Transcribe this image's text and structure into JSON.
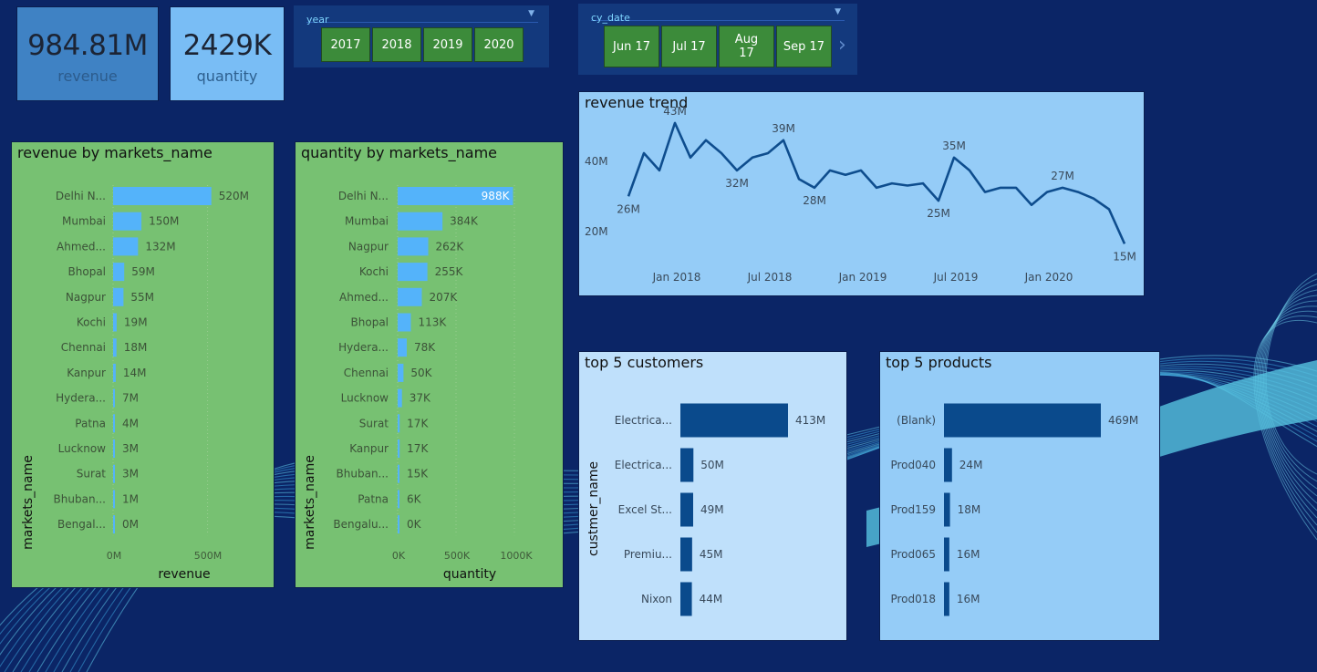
{
  "kpis": [
    {
      "value": "984.81M",
      "label": "revenue"
    },
    {
      "value": "2429K",
      "label": "quantity"
    }
  ],
  "year_slicer": {
    "title": "year",
    "items": [
      "2017",
      "2018",
      "2019",
      "2020"
    ]
  },
  "date_slicer": {
    "title": "cy_date",
    "items": [
      "Jun 17",
      "Jul 17",
      "Aug 17",
      "Sep 17"
    ]
  },
  "revenue_by_market": {
    "title": "revenue by markets_name",
    "xlabel": "revenue",
    "ylabel": "markets_name",
    "ticks": [
      "0M",
      "500M"
    ]
  },
  "quantity_by_market": {
    "title": "quantity by markets_name",
    "xlabel": "quantity",
    "ylabel": "markets_name",
    "ticks": [
      "0K",
      "500K",
      "1000K"
    ]
  },
  "revenue_trend": {
    "title": "revenue trend",
    "yticks": [
      "40M",
      "20M"
    ],
    "xticks": [
      "Jan 2018",
      "Jul 2018",
      "Jan 2019",
      "Jul 2019",
      "Jan 2020"
    ]
  },
  "top_customers": {
    "title": "top 5 customers",
    "ylabel": "custmer_name"
  },
  "top_products": {
    "title": "top 5 products"
  },
  "colors": {
    "background": "#0b2566",
    "green_panel": "#77c172",
    "blue_panel": "#95ccf7",
    "kpi_revenue": "#3f82c4",
    "kpi_quantity": "#79bdf5",
    "bar_light": "#54b3fa",
    "bar_dark": "#0a4a8c",
    "line": "#0e4d8e",
    "tile": "#3c8b3a"
  },
  "chart_data": [
    {
      "type": "bar",
      "orientation": "horizontal",
      "title": "revenue by markets_name",
      "xlabel": "revenue",
      "ylabel": "markets_name",
      "categories": [
        "Delhi N...",
        "Mumbai",
        "Ahmed...",
        "Bhopal",
        "Nagpur",
        "Kochi",
        "Chennai",
        "Kanpur",
        "Hydera...",
        "Patna",
        "Lucknow",
        "Surat",
        "Bhuban...",
        "Bengal..."
      ],
      "values": [
        520,
        150,
        132,
        59,
        55,
        19,
        18,
        14,
        7,
        4,
        3,
        3,
        1,
        0
      ],
      "labels": [
        "520M",
        "150M",
        "132M",
        "59M",
        "55M",
        "19M",
        "18M",
        "14M",
        "7M",
        "4M",
        "3M",
        "3M",
        "1M",
        "0M"
      ],
      "xlim": [
        0,
        700
      ]
    },
    {
      "type": "bar",
      "orientation": "horizontal",
      "title": "quantity by markets_name",
      "xlabel": "quantity",
      "ylabel": "markets_name",
      "categories": [
        "Delhi N...",
        "Mumbai",
        "Nagpur",
        "Kochi",
        "Ahmed...",
        "Bhopal",
        "Hydera...",
        "Chennai",
        "Lucknow",
        "Surat",
        "Kanpur",
        "Bhuban...",
        "Patna",
        "Bengalu..."
      ],
      "values": [
        988,
        384,
        262,
        255,
        207,
        113,
        78,
        50,
        37,
        17,
        17,
        15,
        6,
        0
      ],
      "labels": [
        "988K",
        "384K",
        "262K",
        "255K",
        "207K",
        "113K",
        "78K",
        "50K",
        "37K",
        "17K",
        "17K",
        "15K",
        "6K",
        "0K"
      ],
      "xlim": [
        0,
        1000
      ]
    },
    {
      "type": "line",
      "title": "revenue trend",
      "x": [
        "2017-10",
        "2017-11",
        "2017-12",
        "2018-01",
        "2018-02",
        "2018-03",
        "2018-04",
        "2018-05",
        "2018-06",
        "2018-07",
        "2018-08",
        "2018-09",
        "2018-10",
        "2018-11",
        "2018-12",
        "2019-01",
        "2019-02",
        "2019-03",
        "2019-04",
        "2019-05",
        "2019-06",
        "2019-07",
        "2019-08",
        "2019-09",
        "2019-10",
        "2019-11",
        "2019-12",
        "2020-01",
        "2020-02",
        "2020-03",
        "2020-04",
        "2020-05",
        "2020-06"
      ],
      "values": [
        26,
        36,
        32,
        43,
        35,
        39,
        36,
        32,
        35,
        36,
        39,
        30,
        28,
        32,
        31,
        32,
        28,
        29,
        28.5,
        29,
        25,
        35,
        32,
        27,
        28,
        28,
        24,
        27,
        28,
        27,
        25.5,
        23,
        15
      ],
      "point_labels": [
        {
          "index": 0,
          "text": "26M"
        },
        {
          "index": 3,
          "text": "43M"
        },
        {
          "index": 7,
          "text": "32M"
        },
        {
          "index": 10,
          "text": "39M"
        },
        {
          "index": 12,
          "text": "28M"
        },
        {
          "index": 20,
          "text": "25M"
        },
        {
          "index": 21,
          "text": "35M"
        },
        {
          "index": 28,
          "text": "27M"
        },
        {
          "index": 32,
          "text": "15M"
        }
      ],
      "ylim": [
        10,
        47
      ]
    },
    {
      "type": "bar",
      "orientation": "horizontal",
      "title": "top 5 customers",
      "ylabel": "custmer_name",
      "categories": [
        "Electrica...",
        "Electrica...",
        "Excel St...",
        "Premiu...",
        "Nixon"
      ],
      "values": [
        413,
        50,
        49,
        45,
        44
      ],
      "labels": [
        "413M",
        "50M",
        "49M",
        "45M",
        "44M"
      ],
      "xlim": [
        0,
        413
      ]
    },
    {
      "type": "bar",
      "orientation": "horizontal",
      "title": "top 5 products",
      "categories": [
        "(Blank)",
        "Prod040",
        "Prod159",
        "Prod065",
        "Prod018"
      ],
      "values": [
        469,
        24,
        18,
        16,
        16
      ],
      "labels": [
        "469M",
        "24M",
        "18M",
        "16M",
        "16M"
      ],
      "xlim": [
        0,
        469
      ]
    }
  ]
}
